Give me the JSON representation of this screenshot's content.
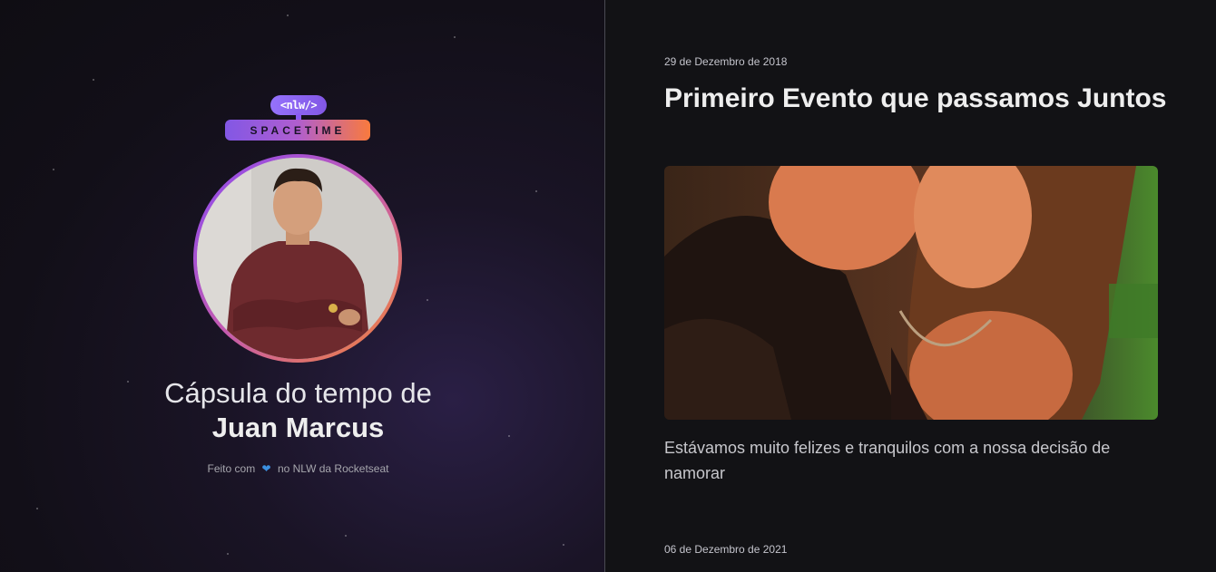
{
  "brand": {
    "logo_top": "<nlw/>",
    "logo_bottom": "SPACETIME"
  },
  "profile": {
    "capsule_prefix": "Cápsula do tempo de",
    "user_name": "Juan Marcus",
    "footer_before": "Feito com",
    "footer_after": "no NLW da Rocketseat",
    "heart_icon": "heart-icon"
  },
  "memories": [
    {
      "date": "29 de Dezembro de 2018",
      "title": "Primeiro Evento que passamos Juntos",
      "text": "Estávamos muito felizes e tranquilos com a nossa decisão de namorar"
    },
    {
      "date": "06 de Dezembro de 2021"
    }
  ],
  "colors": {
    "background": "#121215",
    "purple": "#8257e5",
    "orange": "#f97a3d",
    "heart": "#3b8fe0"
  }
}
